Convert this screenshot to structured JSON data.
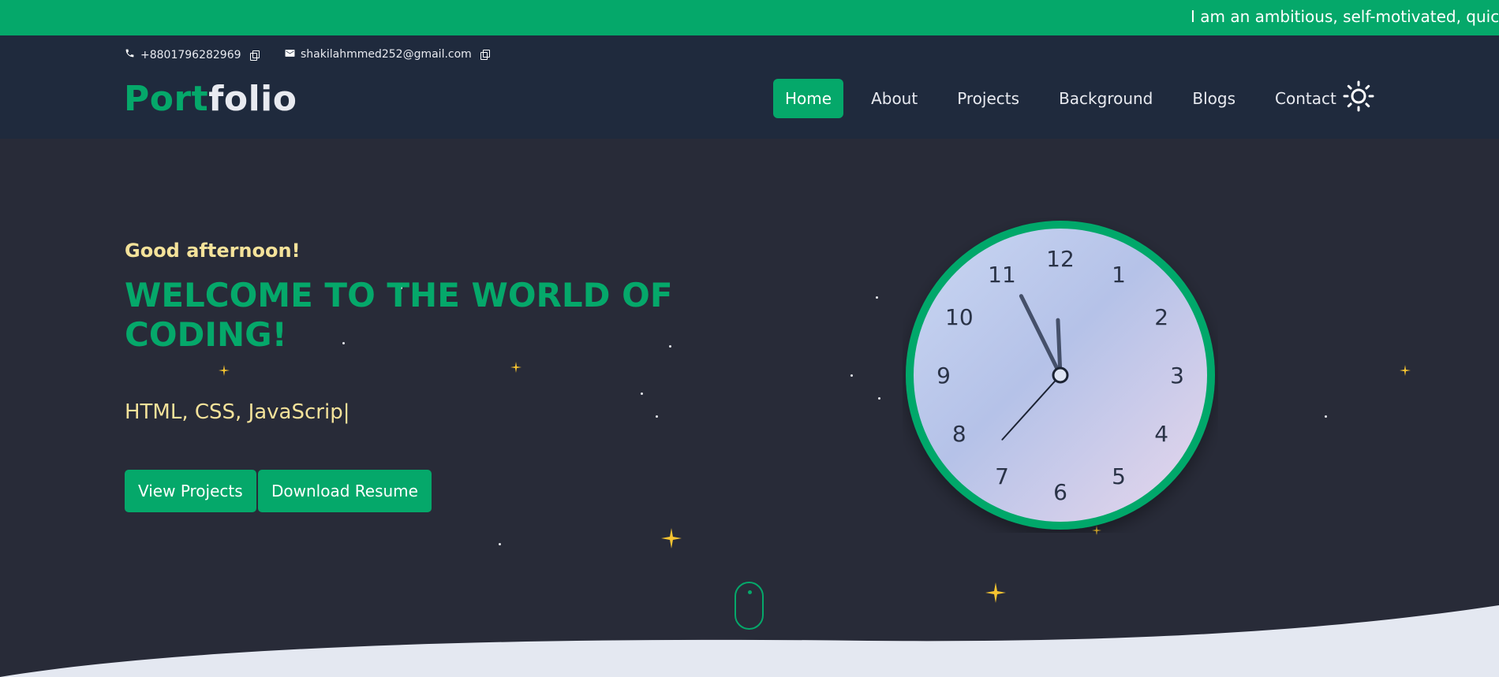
{
  "ticker": {
    "text": "I am an ambitious, self-motivated, quick le"
  },
  "contact": {
    "phone": "+8801796282969",
    "email": "shakilahmmed252@gmail.com"
  },
  "logo": {
    "part1": "Port",
    "part2": "folio"
  },
  "nav": {
    "items": [
      {
        "label": "Home",
        "active": true
      },
      {
        "label": "About"
      },
      {
        "label": "Projects"
      },
      {
        "label": "Background"
      },
      {
        "label": "Blogs"
      },
      {
        "label": "Contact"
      }
    ],
    "theme_toggle_icon": "sun-icon"
  },
  "hero": {
    "greeting": "Good afternoon!",
    "title": "WELCOME TO THE WORLD OF CODING!",
    "typed_text": "HTML, CSS, JavaScrip",
    "caret": "|",
    "buttons": {
      "view": "View Projects",
      "download": "Download Resume"
    }
  },
  "clock": {
    "numbers": [
      "12",
      "1",
      "2",
      "3",
      "4",
      "5",
      "6",
      "7",
      "8",
      "9",
      "10",
      "11"
    ],
    "time": {
      "hour": 11,
      "minute": 55,
      "second": 37
    }
  },
  "colors": {
    "accent": "#05a86a",
    "header_bg": "#1f2a3d",
    "hero_bg": "#282b38",
    "greeting": "#f4e29a",
    "star": "#f6c431"
  }
}
